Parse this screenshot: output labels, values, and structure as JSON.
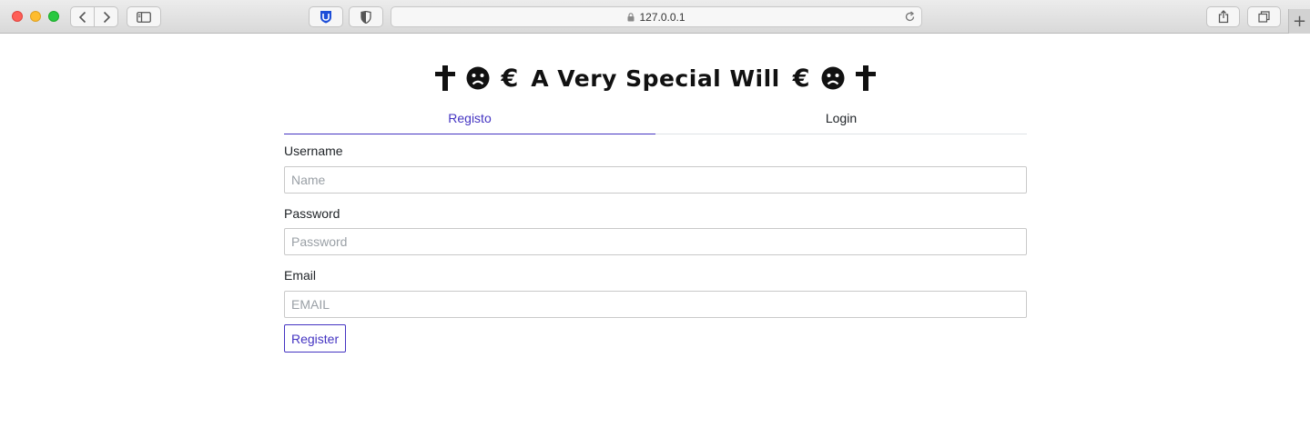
{
  "browser": {
    "address": "127.0.0.1",
    "icons": [
      "back-icon",
      "forward-icon",
      "sidebar-icon",
      "extension-shield-icon",
      "privacy-shield-icon",
      "lock-icon",
      "reload-icon",
      "share-icon",
      "tabs-overview-icon",
      "new-tab-icon"
    ],
    "new_tab_label": "+"
  },
  "header": {
    "title": "A Very Special Will",
    "left_glyphs": [
      "cross",
      "sad-face",
      "€"
    ],
    "right_glyphs": [
      "€",
      "sad-face",
      "cross"
    ],
    "euro": "€"
  },
  "tabs": [
    {
      "label": "Registo",
      "active": true
    },
    {
      "label": "Login",
      "active": false
    }
  ],
  "form": {
    "username_label": "Username",
    "username_placeholder": "Name",
    "username_value": "",
    "password_label": "Password",
    "password_placeholder": "Password",
    "password_value": "",
    "email_label": "Email",
    "email_placeholder": "EMAIL",
    "email_value": "",
    "submit_label": "Register"
  },
  "colors": {
    "accent": "#4434c2",
    "text": "#212529",
    "border": "#c9c9c9"
  }
}
